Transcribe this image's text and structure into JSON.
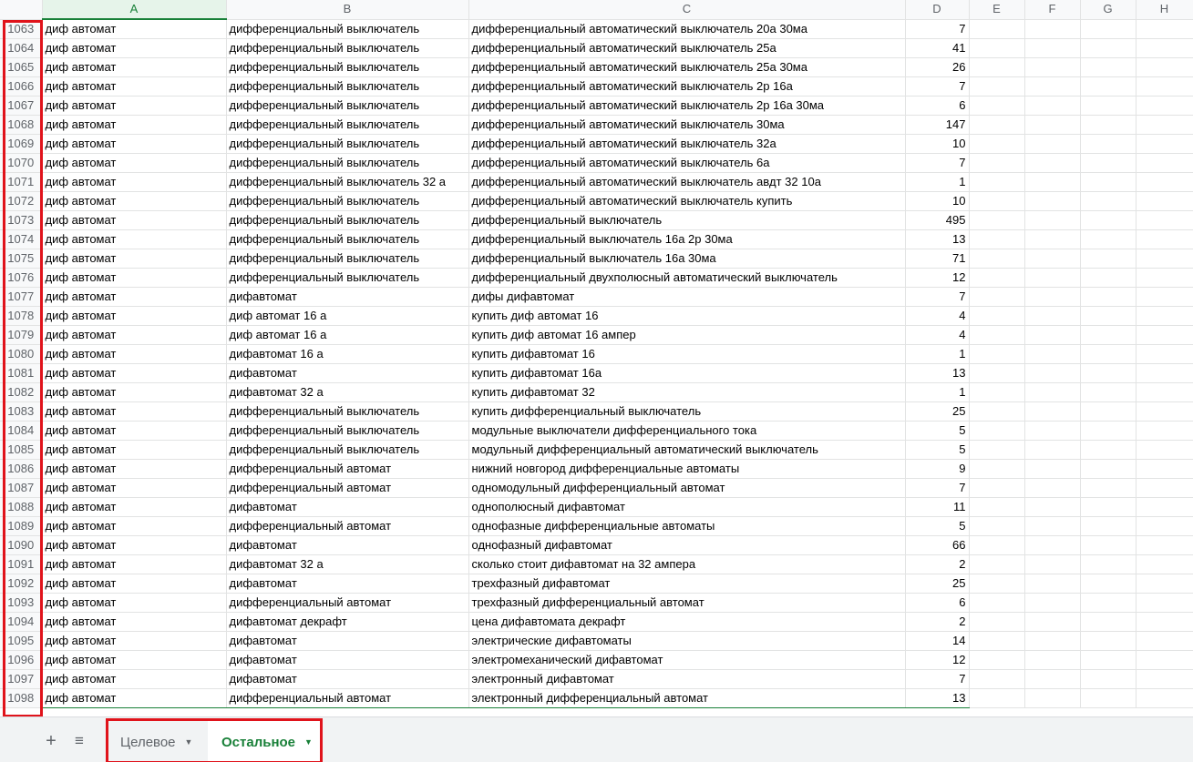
{
  "columns": [
    "A",
    "B",
    "C",
    "D",
    "E",
    "F",
    "G",
    "H"
  ],
  "rows": [
    {
      "n": "1063",
      "a": "диф автомат",
      "b": "дифференциальный выключатель",
      "c": "дифференциальный автоматический выключатель 20а 30ма",
      "d": "7"
    },
    {
      "n": "1064",
      "a": "диф автомат",
      "b": "дифференциальный выключатель",
      "c": "дифференциальный автоматический выключатель 25а",
      "d": "41"
    },
    {
      "n": "1065",
      "a": "диф автомат",
      "b": "дифференциальный выключатель",
      "c": "дифференциальный автоматический выключатель 25а 30ма",
      "d": "26"
    },
    {
      "n": "1066",
      "a": "диф автомат",
      "b": "дифференциальный выключатель",
      "c": "дифференциальный автоматический выключатель 2р 16а",
      "d": "7"
    },
    {
      "n": "1067",
      "a": "диф автомат",
      "b": "дифференциальный выключатель",
      "c": "дифференциальный автоматический выключатель 2р 16а 30ма",
      "d": "6"
    },
    {
      "n": "1068",
      "a": "диф автомат",
      "b": "дифференциальный выключатель",
      "c": "дифференциальный автоматический выключатель 30ма",
      "d": "147"
    },
    {
      "n": "1069",
      "a": "диф автомат",
      "b": "дифференциальный выключатель",
      "c": "дифференциальный автоматический выключатель 32а",
      "d": "10"
    },
    {
      "n": "1070",
      "a": "диф автомат",
      "b": "дифференциальный выключатель",
      "c": "дифференциальный автоматический выключатель 6а",
      "d": "7"
    },
    {
      "n": "1071",
      "a": "диф автомат",
      "b": "дифференциальный выключатель 32 а",
      "c": "дифференциальный автоматический выключатель авдт 32 10а",
      "d": "1"
    },
    {
      "n": "1072",
      "a": "диф автомат",
      "b": "дифференциальный выключатель",
      "c": "дифференциальный автоматический выключатель купить",
      "d": "10"
    },
    {
      "n": "1073",
      "a": "диф автомат",
      "b": "дифференциальный выключатель",
      "c": "дифференциальный выключатель",
      "d": "495"
    },
    {
      "n": "1074",
      "a": "диф автомат",
      "b": "дифференциальный выключатель",
      "c": "дифференциальный выключатель 16а 2р 30ма",
      "d": "13"
    },
    {
      "n": "1075",
      "a": "диф автомат",
      "b": "дифференциальный выключатель",
      "c": "дифференциальный выключатель 16а 30ма",
      "d": "71"
    },
    {
      "n": "1076",
      "a": "диф автомат",
      "b": "дифференциальный выключатель",
      "c": "дифференциальный двухполюсный автоматический выключатель",
      "d": "12"
    },
    {
      "n": "1077",
      "a": "диф автомат",
      "b": "дифавтомат",
      "c": "дифы дифавтомат",
      "d": "7"
    },
    {
      "n": "1078",
      "a": "диф автомат",
      "b": "диф автомат 16 а",
      "c": "купить диф автомат 16",
      "d": "4"
    },
    {
      "n": "1079",
      "a": "диф автомат",
      "b": "диф автомат 16 а",
      "c": "купить диф автомат 16 ампер",
      "d": "4"
    },
    {
      "n": "1080",
      "a": "диф автомат",
      "b": "дифавтомат 16 а",
      "c": "купить дифавтомат 16",
      "d": "1"
    },
    {
      "n": "1081",
      "a": "диф автомат",
      "b": "дифавтомат",
      "c": "купить дифавтомат 16а",
      "d": "13"
    },
    {
      "n": "1082",
      "a": "диф автомат",
      "b": "дифавтомат 32 а",
      "c": "купить дифавтомат 32",
      "d": "1"
    },
    {
      "n": "1083",
      "a": "диф автомат",
      "b": "дифференциальный выключатель",
      "c": "купить дифференциальный выключатель",
      "d": "25"
    },
    {
      "n": "1084",
      "a": "диф автомат",
      "b": "дифференциальный выключатель",
      "c": "модульные выключатели дифференциального тока",
      "d": "5"
    },
    {
      "n": "1085",
      "a": "диф автомат",
      "b": "дифференциальный выключатель",
      "c": "модульный дифференциальный автоматический выключатель",
      "d": "5"
    },
    {
      "n": "1086",
      "a": "диф автомат",
      "b": "дифференциальный автомат",
      "c": "нижний новгород дифференциальные автоматы",
      "d": "9"
    },
    {
      "n": "1087",
      "a": "диф автомат",
      "b": "дифференциальный автомат",
      "c": "одномодульный дифференциальный автомат",
      "d": "7"
    },
    {
      "n": "1088",
      "a": "диф автомат",
      "b": "дифавтомат",
      "c": "однополюсный дифавтомат",
      "d": "11"
    },
    {
      "n": "1089",
      "a": "диф автомат",
      "b": "дифференциальный автомат",
      "c": "однофазные дифференциальные автоматы",
      "d": "5"
    },
    {
      "n": "1090",
      "a": "диф автомат",
      "b": "дифавтомат",
      "c": "однофазный дифавтомат",
      "d": "66"
    },
    {
      "n": "1091",
      "a": "диф автомат",
      "b": "дифавтомат 32 а",
      "c": "сколько стоит дифавтомат на 32 ампера",
      "d": "2"
    },
    {
      "n": "1092",
      "a": "диф автомат",
      "b": "дифавтомат",
      "c": "трехфазный дифавтомат",
      "d": "25"
    },
    {
      "n": "1093",
      "a": "диф автомат",
      "b": "дифференциальный автомат",
      "c": "трехфазный дифференциальный автомат",
      "d": "6"
    },
    {
      "n": "1094",
      "a": "диф автомат",
      "b": "дифавтомат декрафт",
      "c": "цена дифавтомата декрафт",
      "d": "2"
    },
    {
      "n": "1095",
      "a": "диф автомат",
      "b": "дифавтомат",
      "c": "электрические дифавтоматы",
      "d": "14"
    },
    {
      "n": "1096",
      "a": "диф автомат",
      "b": "дифавтомат",
      "c": "электромеханический дифавтомат",
      "d": "12"
    },
    {
      "n": "1097",
      "a": "диф автомат",
      "b": "дифавтомат",
      "c": "электронный дифавтомат",
      "d": "7"
    },
    {
      "n": "1098",
      "a": "диф автомат",
      "b": "дифференциальный автомат",
      "c": "электронный дифференциальный автомат",
      "d": "13"
    }
  ],
  "tabbar": {
    "add_icon": "+",
    "list_icon": "≡",
    "tabs": [
      {
        "label": "Целевое",
        "active": false
      },
      {
        "label": "Остальное",
        "active": true
      }
    ],
    "caret": "▼"
  },
  "colors": {
    "accent": "#188038",
    "highlight": "#e0131b"
  }
}
